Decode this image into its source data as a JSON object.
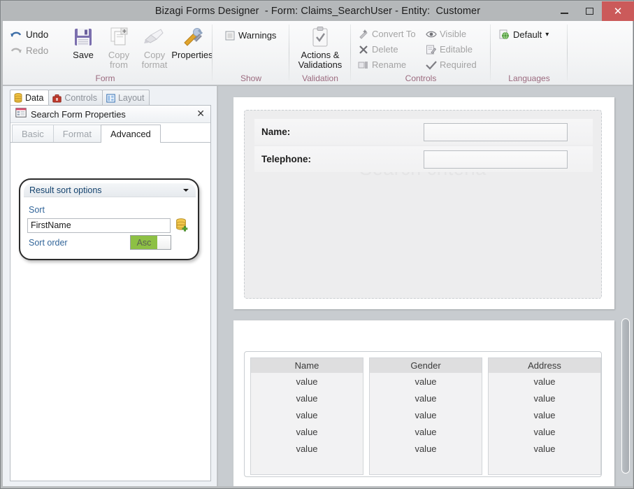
{
  "window": {
    "title": "Bizagi Forms Designer  - Form: Claims_SearchUser - Entity:  Customer",
    "minimize_label": "minimize-icon",
    "maximize_label": "maximize-icon",
    "close_label": "✕"
  },
  "ribbon": {
    "groups": [
      {
        "name": "form",
        "label": "Form"
      },
      {
        "name": "show",
        "label": "Show"
      },
      {
        "name": "validation",
        "label": "Validation"
      },
      {
        "name": "controls",
        "label": "Controls"
      },
      {
        "name": "languages",
        "label": "Languages"
      }
    ],
    "history": [
      {
        "label": "Undo",
        "icon": "undo-arrow-icon",
        "enabled": true
      },
      {
        "label": "Redo",
        "icon": "redo-arrow-icon",
        "enabled": false
      }
    ],
    "form_buttons": [
      {
        "label": "Save",
        "icon": "floppy-disk-icon",
        "enabled": true
      },
      {
        "label": "Copy\nfrom",
        "icon": "copy-from-icon",
        "enabled": false
      },
      {
        "label": "Copy\nformat",
        "icon": "paintbrush-icon",
        "enabled": false
      },
      {
        "label": "Properties",
        "icon": "tools-icon",
        "enabled": true
      }
    ],
    "show_items": [
      {
        "label": "Warnings",
        "icon": "warnings-checkbox-icon",
        "enabled": true
      }
    ],
    "validation_buttons": [
      {
        "label": "Actions &\nValidations",
        "icon": "clipboard-check-icon",
        "enabled": true
      }
    ],
    "controls_items": [
      {
        "label": "Convert To",
        "icon": "wand-icon",
        "enabled": false
      },
      {
        "label": "Delete",
        "icon": "x-mark-icon",
        "enabled": false
      },
      {
        "label": "Rename",
        "icon": "rename-icon",
        "enabled": false
      },
      {
        "label": "Visible",
        "icon": "eye-icon",
        "enabled": false
      },
      {
        "label": "Editable",
        "icon": "pencil-page-icon",
        "enabled": false
      },
      {
        "label": "Required",
        "icon": "check-mark-icon",
        "enabled": false
      }
    ],
    "languages": {
      "selected": "Default",
      "icon": "globe-page-icon",
      "caret": "▾"
    }
  },
  "left_panel": {
    "tabs": [
      {
        "label": "Data",
        "icon": "database-icon",
        "active": true
      },
      {
        "label": "Controls",
        "icon": "toolbox-icon",
        "active": false
      },
      {
        "label": "Layout",
        "icon": "layout-icon",
        "active": false
      }
    ],
    "properties": {
      "header_title": "Search Form Properties",
      "header_icon": "form-properties-icon",
      "close_label": "✕",
      "tabs": [
        {
          "label": "Basic",
          "active": false
        },
        {
          "label": "Format",
          "active": false
        },
        {
          "label": "Advanced",
          "active": true
        }
      ],
      "sort_section": {
        "title": "Result sort options",
        "collapse_caret": "▾",
        "sort_label": "Sort",
        "sort_value": "FirstName",
        "picker_icon": "database-add-icon",
        "sort_order_label": "Sort order",
        "sort_order_value": "Asc",
        "sort_order_accent": "#8dc044"
      }
    }
  },
  "canvas": {
    "search_card": {
      "watermark": "Search criteria",
      "fields": [
        {
          "label": "Name:",
          "value": ""
        },
        {
          "label": "Telephone:",
          "value": ""
        }
      ]
    },
    "results_card": {
      "columns": [
        {
          "header": "Name",
          "cells": [
            "value",
            "value",
            "value",
            "value",
            "value"
          ]
        },
        {
          "header": "Gender",
          "cells": [
            "value",
            "value",
            "value",
            "value",
            "value"
          ]
        },
        {
          "header": "Address",
          "cells": [
            "value",
            "value",
            "value",
            "value",
            "value"
          ]
        }
      ]
    }
  }
}
